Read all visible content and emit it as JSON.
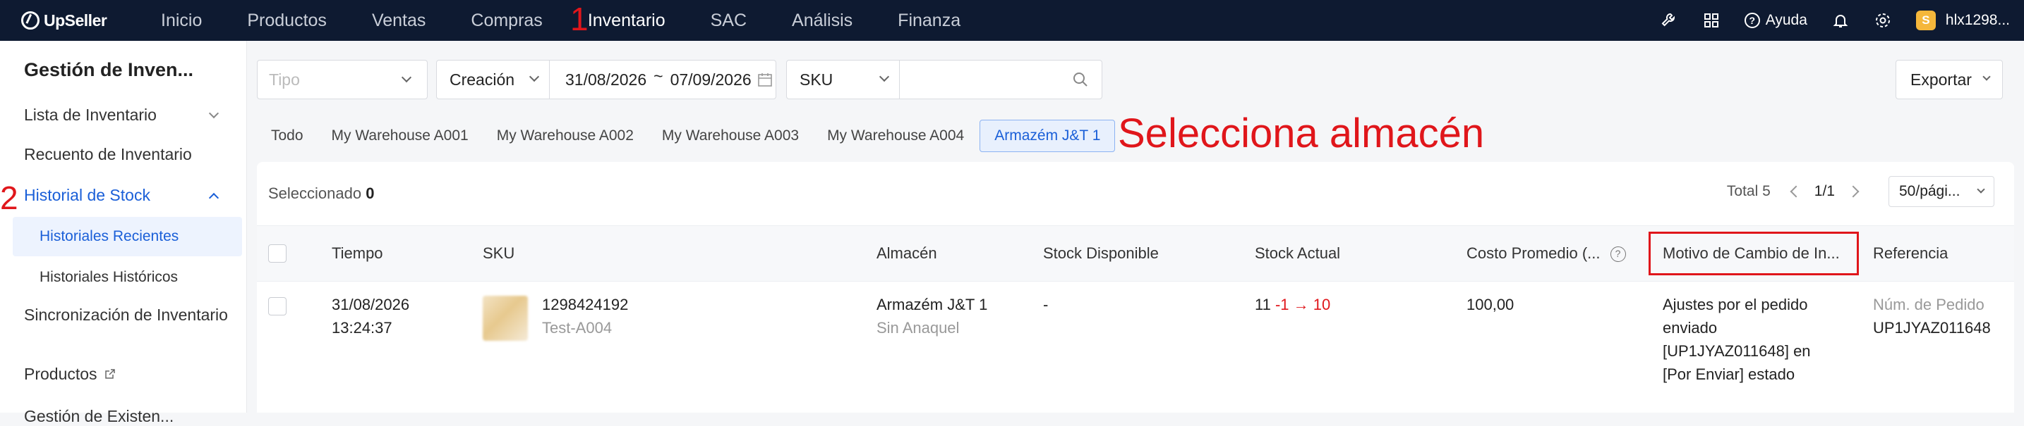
{
  "topbar": {
    "logo": "UpSeller",
    "nav": [
      "Inicio",
      "Productos",
      "Ventas",
      "Compras",
      "Inventario",
      "SAC",
      "Análisis",
      "Finanza"
    ],
    "active_nav": "Inventario",
    "help": "Ayuda",
    "help_icon": "?",
    "username": "hlx1298...",
    "avatar_letter": "S",
    "icons": [
      "wrench-icon",
      "apps-grid-icon",
      "help-icon",
      "bell-icon",
      "gear-icon"
    ]
  },
  "annotations": {
    "step1": "1",
    "step2": "2",
    "select_warehouse": "Selecciona almacén"
  },
  "sidebar": {
    "title": "Gestión de Inven...",
    "items": {
      "lista": "Lista de Inventario",
      "recuento": "Recuento de Inventario",
      "historial": "Historial de Stock",
      "recientes": "Historiales Recientes",
      "historicos": "Historiales Históricos",
      "sincronizacion": "Sincronización de Inventario",
      "productos": "Productos",
      "gestion_extra": "Gestión de Existen..."
    }
  },
  "filters": {
    "tipo_placeholder": "Tipo",
    "date_type": "Creación",
    "date_start": "31/08/2026",
    "date_sep": "~",
    "date_end": "07/09/2026",
    "search_field": "SKU",
    "search_value": ""
  },
  "export_label": "Exportar",
  "tabs": [
    "Todo",
    "My Warehouse A001",
    "My Warehouse A002",
    "My Warehouse A003",
    "My Warehouse A004",
    "Armazém J&T 1"
  ],
  "active_tab": "Armazém J&T 1",
  "table": {
    "selected_label": "Seleccionado",
    "selected_count": "0",
    "total": "Total 5",
    "page": "1/1",
    "page_size": "50/pági...",
    "question_icon": "?",
    "headers": {
      "tiempo": "Tiempo",
      "sku": "SKU",
      "almacen": "Almacén",
      "disponible": "Stock Disponible",
      "actual": "Stock Actual",
      "costo": "Costo Promedio (...",
      "motivo": "Motivo de Cambio de In...",
      "referencia": "Referencia"
    },
    "rows": [
      {
        "date": "31/08/2026",
        "time": "13:24:37",
        "sku_id": "1298424192",
        "sku_name": "Test-A004",
        "warehouse": "Armazém J&T 1",
        "shelf": "Sin Anaquel",
        "available": "-",
        "stock_before": "11",
        "stock_change": "-1 → 10",
        "cost": "100,00",
        "reason_lines": [
          "Ajustes por el pedido",
          "enviado",
          "[UP1JYAZ011648] en",
          "[Por Enviar] estado"
        ],
        "ref_label": "Núm. de Pedido",
        "ref_value": "UP1JYAZ011648"
      }
    ]
  },
  "colors": {
    "topbar_bg": "#0e1a31",
    "accent": "#1a5fd8",
    "annotation_red": "#e0161b"
  }
}
